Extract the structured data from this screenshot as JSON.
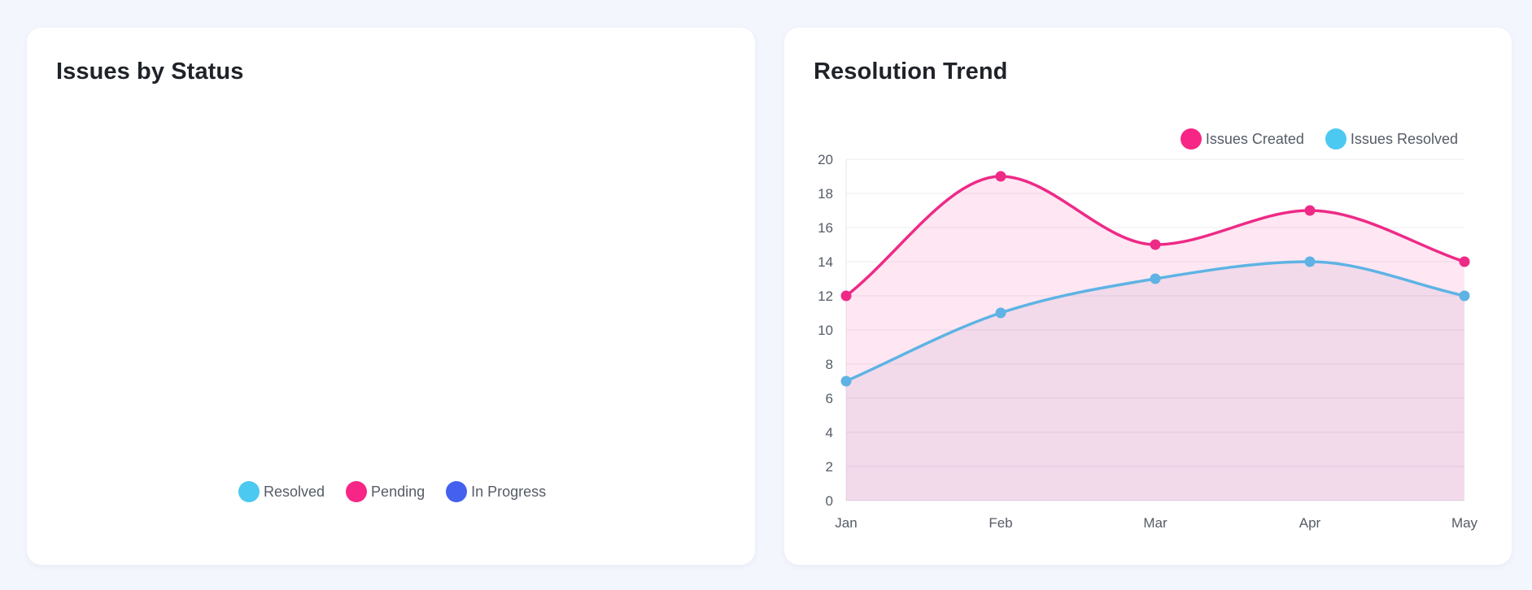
{
  "status_card": {
    "title": "Issues by Status",
    "legend": [
      {
        "label": "Resolved",
        "color": "#4cc9f0"
      },
      {
        "label": "Pending",
        "color": "#f72585"
      },
      {
        "label": "In Progress",
        "color": "#4361ee"
      }
    ]
  },
  "trend_card": {
    "title": "Resolution Trend"
  },
  "chart_data": [
    {
      "type": "pie",
      "title": "Issues by Status",
      "categories": [
        "Resolved",
        "Pending",
        "In Progress"
      ],
      "colors": [
        "#4cc9f0",
        "#f72585",
        "#4361ee"
      ],
      "values": [],
      "legend_position": "bottom"
    },
    {
      "type": "area",
      "title": "Resolution Trend",
      "categories": [
        "Jan",
        "Feb",
        "Mar",
        "Apr",
        "May"
      ],
      "series": [
        {
          "name": "Issues Created",
          "values": [
            12,
            19,
            15,
            17,
            14
          ],
          "color": "#f72585"
        },
        {
          "name": "Issues Resolved",
          "values": [
            7,
            11,
            13,
            14,
            12
          ],
          "color": "#4cc9f0"
        }
      ],
      "ylim": [
        0,
        20
      ],
      "yticks": [
        0,
        2,
        4,
        6,
        8,
        10,
        12,
        14,
        16,
        18,
        20
      ],
      "grid": true,
      "legend_position": "top-right"
    }
  ]
}
